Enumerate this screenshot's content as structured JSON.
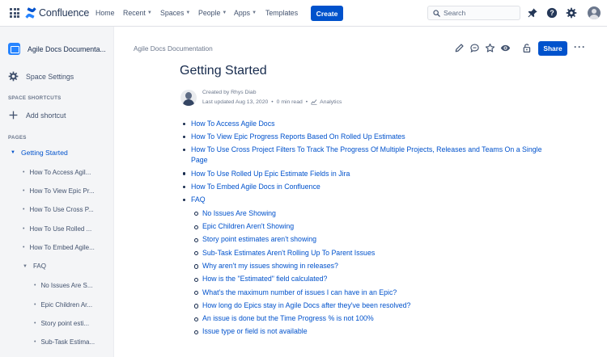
{
  "topnav": {
    "brand": "Confluence",
    "links": [
      {
        "label": "Home",
        "dropdown": false
      },
      {
        "label": "Recent",
        "dropdown": true
      },
      {
        "label": "Spaces",
        "dropdown": true
      },
      {
        "label": "People",
        "dropdown": true
      },
      {
        "label": "Apps",
        "dropdown": true
      },
      {
        "label": "Templates",
        "dropdown": false
      }
    ],
    "create_label": "Create",
    "search_placeholder": "Search",
    "icons": [
      "notifications-icon",
      "help-icon",
      "settings-icon",
      "avatar"
    ]
  },
  "sidebar": {
    "space_name": "Agile Docs Documenta...",
    "space_settings": "Space Settings",
    "shortcuts_header": "SPACE SHORTCUTS",
    "add_shortcut": "Add shortcut",
    "pages_header": "PAGES",
    "tree": [
      {
        "label": "Getting Started",
        "active": true,
        "toggle": "expanded"
      },
      {
        "label": "How To Access Agil..."
      },
      {
        "label": "How To View Epic Pr..."
      },
      {
        "label": "How To Use Cross P..."
      },
      {
        "label": "How To Use Rolled ..."
      },
      {
        "label": "How To Embed Agile..."
      },
      {
        "label": "FAQ",
        "toggle": "expanded"
      },
      {
        "label": "No Issues Are S..."
      },
      {
        "label": "Epic Children Ar..."
      },
      {
        "label": "Story point esti..."
      },
      {
        "label": "Sub-Task Estima..."
      }
    ]
  },
  "page": {
    "breadcrumb": "Agile Docs Documentation",
    "share_label": "Share",
    "title": "Getting Started",
    "created_by": "Created by Rhys Diab",
    "last_updated": "Last updated Aug 13, 2020",
    "read_time": "0 min read",
    "analytics": "Analytics",
    "toc": [
      "How To Access Agile Docs",
      "How To View Epic Progress Reports Based On Rolled Up Estimates",
      "How To Use Cross Project Filters To Track The Progress Of Multiple Projects, Releases and Teams On a Single Page",
      "How To Use Rolled Up Epic Estimate Fields in Jira",
      "How To Embed Agile Docs in Confluence",
      "FAQ"
    ],
    "faq": [
      "No Issues Are Showing",
      "Epic Children Aren't Showing",
      "Story point estimates aren't showing",
      "Sub-Task Estimates Aren't Rolling Up To Parent Issues",
      "Why aren't my issues showing in releases?",
      "How is the \"Estimated\" field calculated?",
      "What's the maximum number of issues I can have in an Epic?",
      "How long do Epics stay in Agile Docs after they've been resolved?",
      "An issue is done but the Time Progress % is not 100%",
      "Issue type or field is not available"
    ]
  }
}
